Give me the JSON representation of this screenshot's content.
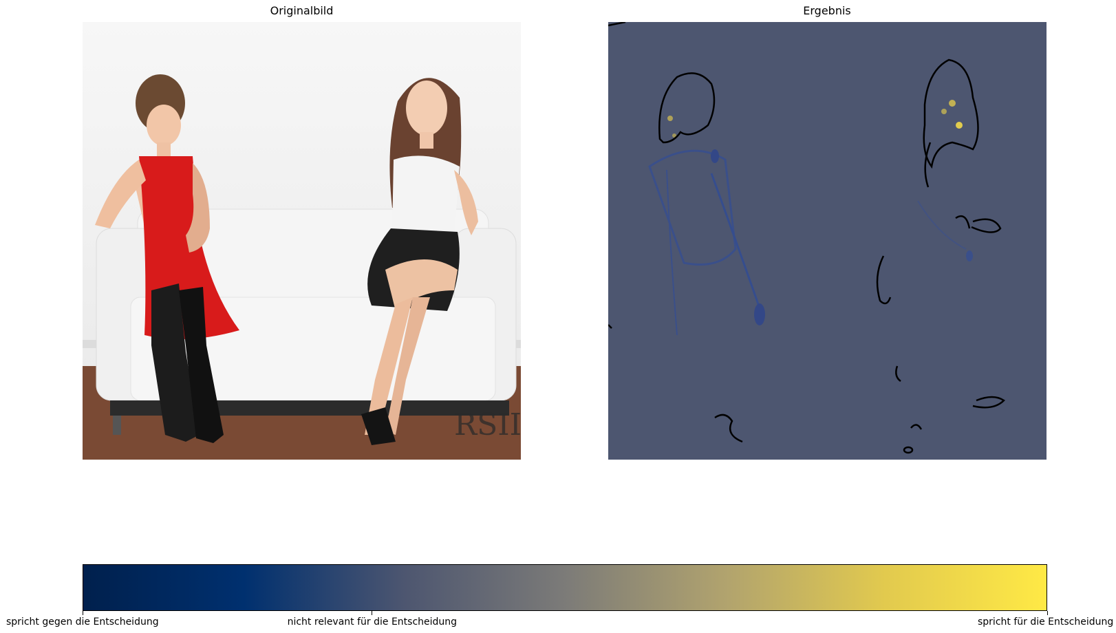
{
  "panels": {
    "left": {
      "title": "Originalbild"
    },
    "right": {
      "title": "Ergebnis"
    }
  },
  "colorbar": {
    "colormap": "cividis",
    "colors": [
      "#00204d",
      "#00306f",
      "#4d5670",
      "#7c7b78",
      "#b1a36e",
      "#e2ca4e",
      "#ffe945"
    ],
    "ticks": [
      {
        "label": "spricht gegen die Entscheidung",
        "value": 0.0
      },
      {
        "label": "nicht relevant für die Entscheidung",
        "value": 0.3
      },
      {
        "label": "spricht für die Entscheidung",
        "value": 1.0
      }
    ]
  },
  "photo_watermark": "RSII"
}
